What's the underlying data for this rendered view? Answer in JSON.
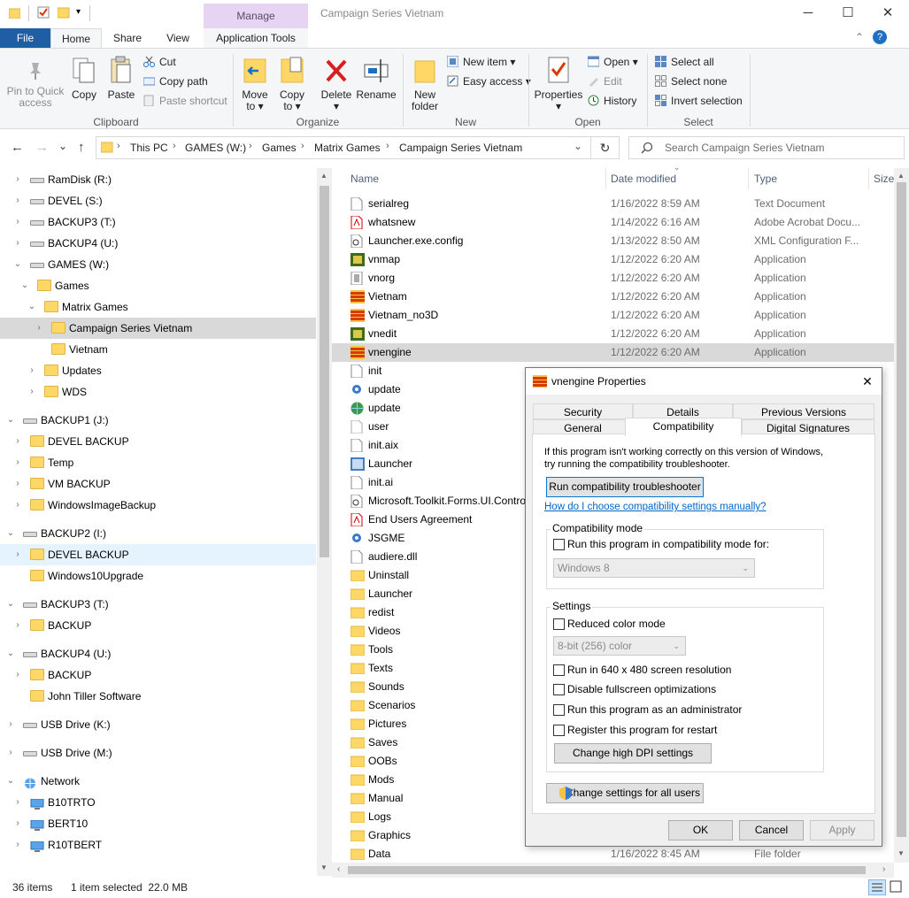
{
  "window": {
    "title": "Campaign Series Vietnam",
    "manage_label": "Manage",
    "minimize": "─",
    "maximize": "☐",
    "close": "✕"
  },
  "menu": {
    "file": "File",
    "home": "Home",
    "share": "Share",
    "view": "View",
    "app_tools": "Application Tools",
    "help": "?",
    "collapse": "⌃"
  },
  "ribbon": {
    "clipboard": {
      "pin_line1": "Pin to Quick",
      "pin_line2": "access",
      "copy": "Copy",
      "paste": "Paste",
      "cut": "Cut",
      "copy_path": "Copy path",
      "paste_shortcut": "Paste shortcut",
      "group": "Clipboard"
    },
    "organize": {
      "move_line1": "Move",
      "move_line2": "to ▾",
      "copy_line1": "Copy",
      "copy_line2": "to ▾",
      "delete_line1": "Delete",
      "delete_line2": "▾",
      "rename": "Rename",
      "group": "Organize"
    },
    "new": {
      "folder_line1": "New",
      "folder_line2": "folder",
      "new_item": "New item ▾",
      "easy_access": "Easy access ▾",
      "group": "New"
    },
    "open": {
      "properties_line1": "Properties",
      "properties_line2": "▾",
      "open": "Open ▾",
      "edit": "Edit",
      "history": "History",
      "group": "Open"
    },
    "select": {
      "select_all": "Select all",
      "select_none": "Select none",
      "invert": "Invert selection",
      "group": "Select"
    }
  },
  "address": {
    "back": "←",
    "forward": "→",
    "recent": "⌄",
    "up": "↑",
    "crumbs": [
      "This PC",
      "GAMES (W:)",
      "Games",
      "Matrix Games",
      "Campaign Series Vietnam"
    ],
    "dropdown": "⌄",
    "refresh": "↻",
    "search_placeholder": "Search Campaign Series Vietnam"
  },
  "tree": [
    {
      "label": "RamDisk (R:)",
      "kind": "drive",
      "chev": "›"
    },
    {
      "label": "DEVEL (S:)",
      "kind": "drive",
      "chev": "›"
    },
    {
      "label": "BACKUP3 (T:)",
      "kind": "drive",
      "chev": "›"
    },
    {
      "label": "BACKUP4 (U:)",
      "kind": "drive",
      "chev": "›"
    },
    {
      "label": "GAMES (W:)",
      "kind": "drive",
      "chev": "⌄"
    },
    {
      "label": "Games",
      "kind": "folder",
      "chev": "⌄"
    },
    {
      "label": "Matrix Games",
      "kind": "folder",
      "chev": "⌄"
    },
    {
      "label": "Campaign Series Vietnam",
      "kind": "folder",
      "chev": "›"
    },
    {
      "label": "Vietnam",
      "kind": "folder",
      "chev": ""
    },
    {
      "label": "Updates",
      "kind": "folder",
      "chev": "›"
    },
    {
      "label": "WDS",
      "kind": "folder",
      "chev": "›"
    },
    {
      "label": "BACKUP1 (J:)",
      "kind": "drive",
      "chev": "⌄"
    },
    {
      "label": "DEVEL BACKUP",
      "kind": "folder",
      "chev": "›"
    },
    {
      "label": "Temp",
      "kind": "folder",
      "chev": "›"
    },
    {
      "label": "VM BACKUP",
      "kind": "folder",
      "chev": "›"
    },
    {
      "label": "WindowsImageBackup",
      "kind": "folder",
      "chev": "›"
    },
    {
      "label": "BACKUP2 (I:)",
      "kind": "drive",
      "chev": "⌄"
    },
    {
      "label": "DEVEL BACKUP",
      "kind": "folder",
      "chev": "›"
    },
    {
      "label": "Windows10Upgrade",
      "kind": "folder",
      "chev": ""
    },
    {
      "label": "BACKUP3 (T:)",
      "kind": "drive",
      "chev": "⌄"
    },
    {
      "label": "BACKUP",
      "kind": "folder",
      "chev": "›"
    },
    {
      "label": "BACKUP4 (U:)",
      "kind": "drive",
      "chev": "⌄"
    },
    {
      "label": "BACKUP",
      "kind": "folder",
      "chev": "›"
    },
    {
      "label": "John Tiller Software",
      "kind": "folder",
      "chev": ""
    },
    {
      "label": "USB Drive (K:)",
      "kind": "drive",
      "chev": "›"
    },
    {
      "label": "USB Drive (M:)",
      "kind": "drive",
      "chev": "›"
    },
    {
      "label": "Network",
      "kind": "network",
      "chev": "⌄"
    },
    {
      "label": "B10TRTO",
      "kind": "pc",
      "chev": "›"
    },
    {
      "label": "BERT10",
      "kind": "pc",
      "chev": "›"
    },
    {
      "label": "R10TBERT",
      "kind": "pc",
      "chev": "›"
    }
  ],
  "columns": {
    "name": "Name",
    "date": "Date modified",
    "type": "Type",
    "size": "Size"
  },
  "files": [
    {
      "name": "serialreg",
      "date": "1/16/2022 8:59 AM",
      "type": "Text Document",
      "icon": "doc"
    },
    {
      "name": "whatsnew",
      "date": "1/14/2022 6:16 AM",
      "type": "Adobe Acrobat Docu...",
      "icon": "pdf"
    },
    {
      "name": "Launcher.exe.config",
      "date": "1/13/2022 8:50 AM",
      "type": "XML Configuration F...",
      "icon": "config"
    },
    {
      "name": "vnmap",
      "date": "1/12/2022 6:20 AM",
      "type": "Application",
      "icon": "map"
    },
    {
      "name": "vnorg",
      "date": "1/12/2022 6:20 AM",
      "type": "Application",
      "icon": "org"
    },
    {
      "name": "Vietnam",
      "date": "1/12/2022 6:20 AM",
      "type": "Application",
      "icon": "flag"
    },
    {
      "name": "Vietnam_no3D",
      "date": "1/12/2022 6:20 AM",
      "type": "Application",
      "icon": "flag"
    },
    {
      "name": "vnedit",
      "date": "1/12/2022 6:20 AM",
      "type": "Application",
      "icon": "map"
    },
    {
      "name": "vnengine",
      "date": "1/12/2022 6:20 AM",
      "type": "Application",
      "icon": "flag"
    },
    {
      "name": "init",
      "date": "",
      "type": "",
      "icon": "doc"
    },
    {
      "name": "update",
      "date": "",
      "type": "",
      "icon": "gear"
    },
    {
      "name": "update",
      "date": "",
      "type": "",
      "icon": "globe"
    },
    {
      "name": "user",
      "date": "",
      "type": "",
      "icon": "blank"
    },
    {
      "name": "init.aix",
      "date": "",
      "type": "",
      "icon": "doc"
    },
    {
      "name": "Launcher",
      "date": "",
      "type": "",
      "icon": "app"
    },
    {
      "name": "init.ai",
      "date": "",
      "type": "",
      "icon": "doc"
    },
    {
      "name": "Microsoft.Toolkit.Forms.UI.Contro",
      "date": "",
      "type": "",
      "icon": "config"
    },
    {
      "name": "End Users Agreement",
      "date": "",
      "type": "",
      "icon": "pdf"
    },
    {
      "name": "JSGME",
      "date": "",
      "type": "",
      "icon": "gear"
    },
    {
      "name": "audiere.dll",
      "date": "",
      "type": "",
      "icon": "doc"
    },
    {
      "name": "Uninstall",
      "date": "",
      "type": "",
      "icon": "folder"
    },
    {
      "name": "Launcher",
      "date": "",
      "type": "",
      "icon": "folder"
    },
    {
      "name": "redist",
      "date": "",
      "type": "",
      "icon": "folder"
    },
    {
      "name": "Videos",
      "date": "",
      "type": "",
      "icon": "folder"
    },
    {
      "name": "Tools",
      "date": "",
      "type": "",
      "icon": "folder"
    },
    {
      "name": "Texts",
      "date": "",
      "type": "",
      "icon": "folder"
    },
    {
      "name": "Sounds",
      "date": "",
      "type": "",
      "icon": "folder"
    },
    {
      "name": "Scenarios",
      "date": "",
      "type": "",
      "icon": "folder"
    },
    {
      "name": "Pictures",
      "date": "",
      "type": "",
      "icon": "folder"
    },
    {
      "name": "Saves",
      "date": "",
      "type": "",
      "icon": "folder"
    },
    {
      "name": "OOBs",
      "date": "",
      "type": "",
      "icon": "folder"
    },
    {
      "name": "Mods",
      "date": "",
      "type": "",
      "icon": "folder"
    },
    {
      "name": "Manual",
      "date": "",
      "type": "",
      "icon": "folder"
    },
    {
      "name": "Logs",
      "date": "",
      "type": "",
      "icon": "folder"
    },
    {
      "name": "Graphics",
      "date": "",
      "type": "",
      "icon": "folder"
    },
    {
      "name": "Data",
      "date": "1/16/2022 8:45 AM",
      "type": "File folder",
      "icon": "folder"
    }
  ],
  "status": {
    "count": "36 items",
    "selected": "1 item selected  22.0 MB"
  },
  "dialog": {
    "title": "vnengine Properties",
    "close": "✕",
    "tabs_top": [
      "Security",
      "Details",
      "Previous Versions"
    ],
    "tabs_bottom": [
      "General",
      "Compatibility",
      "Digital Signatures"
    ],
    "intro_line1": "If this program isn't working correctly on this version of Windows,",
    "intro_line2": "try running the compatibility troubleshooter.",
    "troubleshooter_button": "Run compatibility troubleshooter",
    "manual_link": "How do I choose compatibility settings manually?",
    "compat_group": "Compatibility mode",
    "compat_check": "Run this program in compatibility mode for:",
    "compat_os": "Windows 8",
    "settings_group": "Settings",
    "reduced_color": "Reduced color mode",
    "color_option": "8-bit (256) color",
    "res_640": "Run in 640 x 480 screen resolution",
    "fullscreen": "Disable fullscreen optimizations",
    "admin": "Run this program as an administrator",
    "restart": "Register this program for restart",
    "dpi_button": "Change high DPI settings",
    "all_users_button": "Change settings for all users",
    "ok": "OK",
    "cancel": "Cancel",
    "apply": "Apply"
  }
}
